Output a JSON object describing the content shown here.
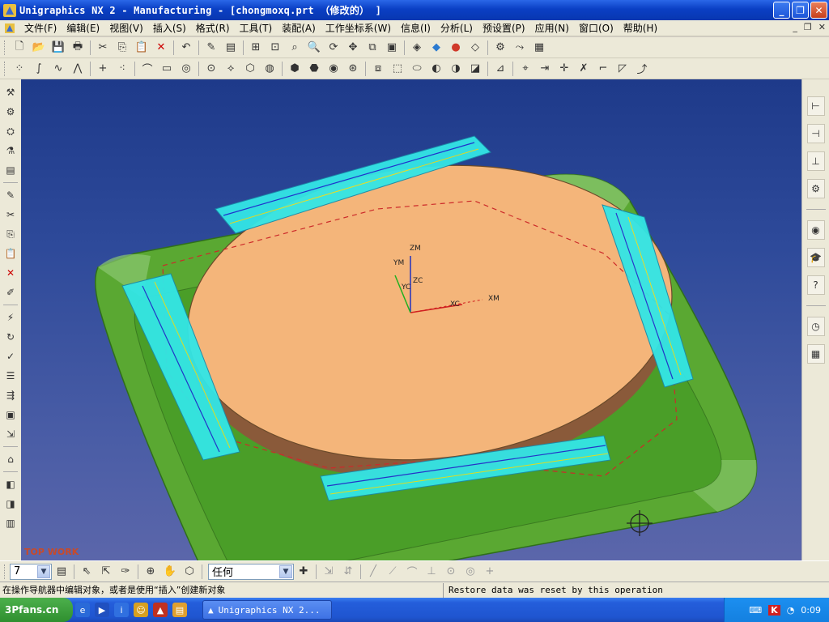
{
  "window": {
    "title": "Unigraphics NX 2 - Manufacturing - [chongmoxq.prt （修改的） ]",
    "controls": [
      "minimize",
      "maximize",
      "close"
    ]
  },
  "menubar": {
    "items": [
      "文件(F)",
      "编辑(E)",
      "视图(V)",
      "插入(S)",
      "格式(R)",
      "工具(T)",
      "装配(A)",
      "工作坐标系(W)",
      "信息(I)",
      "分析(L)",
      "预设置(P)",
      "应用(N)",
      "窗口(O)",
      "帮助(H)"
    ]
  },
  "toolbar1": {
    "icons": [
      "new-icon",
      "open-icon",
      "save-icon",
      "print-icon",
      "cut-icon",
      "copy-icon",
      "paste-icon",
      "delete-icon",
      "undo-icon",
      "edit-object-icon",
      "properties-icon",
      "fit-icon",
      "zoom-area-icon",
      "zoom-icon",
      "rotate-icon",
      "pan-icon",
      "layout-icon",
      "view-orient-icon",
      "render-style-icon",
      "shade-icon",
      "wcs-icon",
      "analysis-icon",
      "toolpath-icon",
      "generate-icon"
    ]
  },
  "toolbar2": {
    "icons": [
      "point-icon",
      "spline-icon",
      "curve-icon",
      "polyline-icon",
      "plus-icon",
      "point-set-icon",
      "arc-icon",
      "rectangle-icon",
      "circle-icon",
      "sketch-icon",
      "offset-icon",
      "extrude-icon",
      "revolve-icon",
      "shell-icon",
      "feature-icon",
      "hole-icon",
      "boss-icon",
      "pocket-icon",
      "pad-icon",
      "slot-icon",
      "groove-icon",
      "measure-icon",
      "trim-icon",
      "extend-icon",
      "fillet-icon",
      "chamfer-icon"
    ]
  },
  "viewport": {
    "corner_label": "TOP WORK",
    "axis_labels": {
      "zm": "ZM",
      "ym": "YM",
      "yc": "YC",
      "zc": "ZC",
      "xc": "XC",
      "xm": "XM"
    },
    "colors": {
      "background_top": "#1e3a8a",
      "plate": "#5aa832",
      "disc_top": "#f4b57a",
      "disc_side": "#8a5a3a",
      "toolpath": "#33e6e6",
      "dashes": "#cc2a2a"
    }
  },
  "selection_bar": {
    "layer_value": "7",
    "filter_value": "任何"
  },
  "status": {
    "left": "在操作导航器中编辑对象，或者是使用“插入”创建新对象",
    "right": "Restore data was reset by this operation"
  },
  "taskbar": {
    "start_label": "3Pfans.cn",
    "task_label": "Unigraphics NX 2...",
    "clock": "0:09"
  }
}
